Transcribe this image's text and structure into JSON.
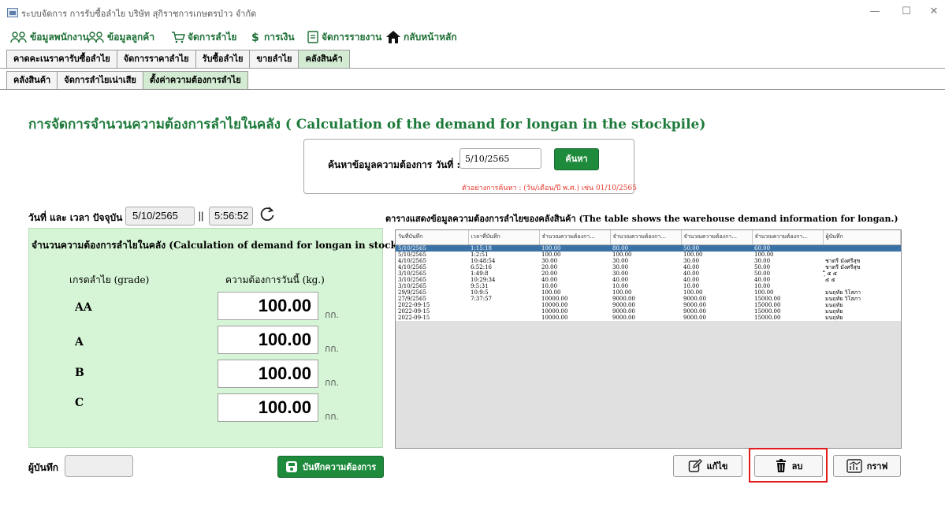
{
  "window": {
    "title": "ระบบจัดการ การรับซื้อลำไย บริษัท สุกิราชการเกษตรป่าว จำกัด",
    "minimize_glyph": "—",
    "maximize_glyph": "☐",
    "close_glyph": "✕"
  },
  "menu": {
    "items": [
      {
        "label": "ข้อมูลพนักงาน",
        "icon": "users-icon"
      },
      {
        "label": "ข้อมูลลูกค้า",
        "icon": "customers-icon"
      },
      {
        "label": "จัดการลำไย",
        "icon": "cart-icon"
      },
      {
        "label": "การเงิน",
        "icon": "dollar-icon"
      },
      {
        "label": "จัดการรายงาน",
        "icon": "report-icon"
      },
      {
        "label": "กลับหน้าหลัก",
        "icon": "home-icon"
      }
    ]
  },
  "tabs_main": [
    {
      "label": "คาดคะเนราคารับซื้อลำไย",
      "active": false
    },
    {
      "label": "จัดการราคาลำไย",
      "active": false
    },
    {
      "label": "รับซื้อลำไย",
      "active": false
    },
    {
      "label": "ขายลำไย",
      "active": false
    },
    {
      "label": "คลังสินค้า",
      "active": true
    }
  ],
  "tabs_sub": [
    {
      "label": "คลังสินค้า",
      "active": false
    },
    {
      "label": "จัดการลำไยเน่าเสีย",
      "active": false
    },
    {
      "label": "ตั้งค่าความต้องการลำไย",
      "active": true
    }
  ],
  "heading": "การจัดการจำนวนความต้องการลำไยในคลัง ( Calculation of the demand for longan in the stockpile)",
  "search": {
    "label": "ค้นหาข้อมูลความต้องการ วันที่ :",
    "value": "5/10/2565",
    "button_label": "ค้นหา",
    "hint": "ตัวอย่างการค้นหา : (วัน/เดือน/ปี พ.ศ.) เช่น 01/10/2565"
  },
  "now": {
    "label": "วันที่ และ เวลา ปัจจุบัน :",
    "date": "5/10/2565",
    "separator": "||",
    "time": "5:56:52"
  },
  "demand_panel": {
    "title": "จำนวนความต้องการลำไยในคลัง (Calculation of demand for longan in stock)",
    "grade_header": "เกรดลำไย (grade)",
    "demand_header": "ความต้องการวันนี้ (kg.)",
    "rows": [
      {
        "grade": "AA",
        "value": "100.00",
        "unit": "กก."
      },
      {
        "grade": "A",
        "value": "100.00",
        "unit": "กก."
      },
      {
        "grade": "B",
        "value": "100.00",
        "unit": "กก."
      },
      {
        "grade": "C",
        "value": "100.00",
        "unit": "กก."
      }
    ]
  },
  "recorder": {
    "label": "ผู้บันทึก",
    "value": ""
  },
  "save_button_label": "บันทึกความต้องการ",
  "table": {
    "caption": "ตารางแสดงข้อมูลความต้องการลำไยของคลังสินค้า (The table shows the warehouse demand information for longan.)",
    "headers": [
      "วันที่บันทึก",
      "เวลาที่บันทึก",
      "จำนวณความต้องกา...",
      "จำนวณความต้องกา...",
      "จำนวณความต้องกา...",
      "จำนวณความต้องกา...",
      "ผู้บันทึก"
    ],
    "rows": [
      [
        "5/10/2565",
        "1:15:18",
        "100.00",
        "80.00",
        "50.00",
        "60.00",
        ""
      ],
      [
        "5/10/2565",
        "1:2:51",
        "100.00",
        "100.00",
        "100.00",
        "100.00",
        ""
      ],
      [
        "4/10/2565",
        "10:48:54",
        "30.00",
        "30.00",
        "30.00",
        "30.00",
        "ชาตรี มั่งศรีสุข"
      ],
      [
        "4/10/2565",
        "6:52:16",
        "20.00",
        "30.00",
        "40.00",
        "50.00",
        "ชาตรี มั่งศรีสุข"
      ],
      [
        "3/10/2565",
        "1:49:8",
        "20.00",
        "30.00",
        "40.00",
        "50.00",
        "ุี ๕ ๕"
      ],
      [
        "3/10/2565",
        "10:29:34",
        "40.00",
        "40.00",
        "40.00",
        "40.00",
        "๕ ๕"
      ],
      [
        "3/10/2565",
        "9:5:31",
        "10.00",
        "10.00",
        "10.00",
        "10.00",
        ""
      ],
      [
        "29/9/2565",
        "10:9:5",
        "100.00",
        "100.00",
        "100.00",
        "100.00",
        "มนฤทัย วิโสภา"
      ],
      [
        "27/9/2565",
        "7:37:57",
        "10000.00",
        "9000.00",
        "9000.00",
        "15000.00",
        "มนฤทัย วิโสภา"
      ],
      [
        "2022-09-15",
        "",
        "10000.00",
        "9000.00",
        "9000.00",
        "15000.00",
        "มนฤทัย"
      ],
      [
        "2022-09-15",
        "",
        "10000.00",
        "9000.00",
        "9000.00",
        "15000.00",
        "มนฤทัย"
      ],
      [
        "2022-09-15",
        "",
        "10000.00",
        "9000.00",
        "9000.00",
        "15000.00",
        "มนฤทัย"
      ]
    ],
    "selected_row": 0
  },
  "actions": {
    "edit_label": "แก้ไข",
    "delete_label": "ลบ",
    "graph_label": "กราฟ"
  },
  "colors": {
    "accent_green": "#1e8b3c",
    "panel_green": "#d6f5d6",
    "heading_green": "#1d7a3a",
    "hint_red": "#e8392c",
    "selection_blue": "#3b72a6",
    "highlight_red": "#e21b1b"
  }
}
